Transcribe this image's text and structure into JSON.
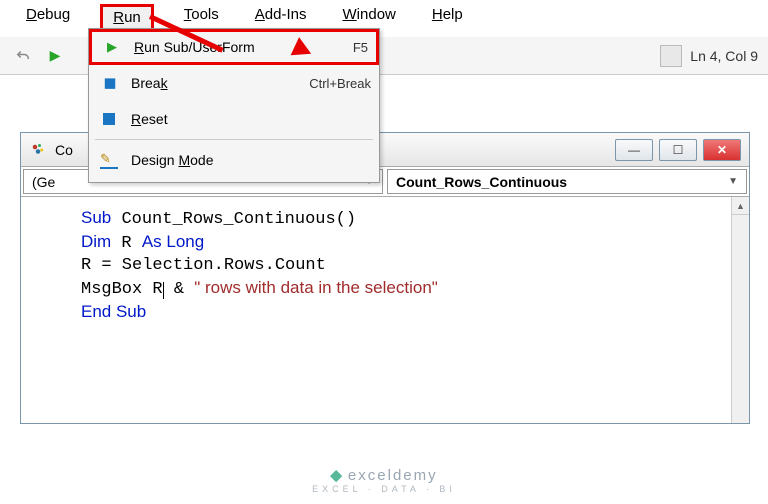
{
  "menu": {
    "debug": "Debug",
    "run": "Run",
    "tools": "Tools",
    "addins": "Add-Ins",
    "window": "Window",
    "help": "Help"
  },
  "dropdown": {
    "run_sub": {
      "label": "Run Sub/UserForm",
      "shortcut": "F5"
    },
    "break": {
      "label": "Break",
      "shortcut": "Ctrl+Break"
    },
    "reset": {
      "label": "Reset"
    },
    "design": {
      "label": "Design Mode"
    }
  },
  "status": {
    "position": "Ln 4, Col 9"
  },
  "codewin": {
    "title": "Co",
    "dd_left": "(Ge",
    "dd_right": "Count_Rows_Continuous"
  },
  "chart_data": {
    "type": "table",
    "title": "VBA code module",
    "language": "VBA",
    "lines": [
      "Sub Count_Rows_Continuous()",
      "Dim R As Long",
      "R = Selection.Rows.Count",
      "MsgBox R & \" rows with data in the selection\"",
      "End Sub"
    ],
    "tokens": [
      [
        [
          "kw",
          "Sub"
        ],
        [
          "txt",
          " Count_Rows_Continuous()"
        ]
      ],
      [
        [
          "kw",
          "Dim"
        ],
        [
          "txt",
          " R "
        ],
        [
          "kw",
          "As Long"
        ]
      ],
      [
        [
          "txt",
          "R = Selection.Rows.Count"
        ]
      ],
      [
        [
          "txt",
          "MsgBox R"
        ],
        [
          "cursor",
          ""
        ],
        [
          "txt",
          " & "
        ],
        [
          "str",
          "\" rows with data in the selection\""
        ]
      ],
      [
        [
          "kw",
          "End Sub"
        ]
      ]
    ]
  },
  "watermark": {
    "brand": "exceldemy",
    "sub": "EXCEL · DATA · BI"
  }
}
